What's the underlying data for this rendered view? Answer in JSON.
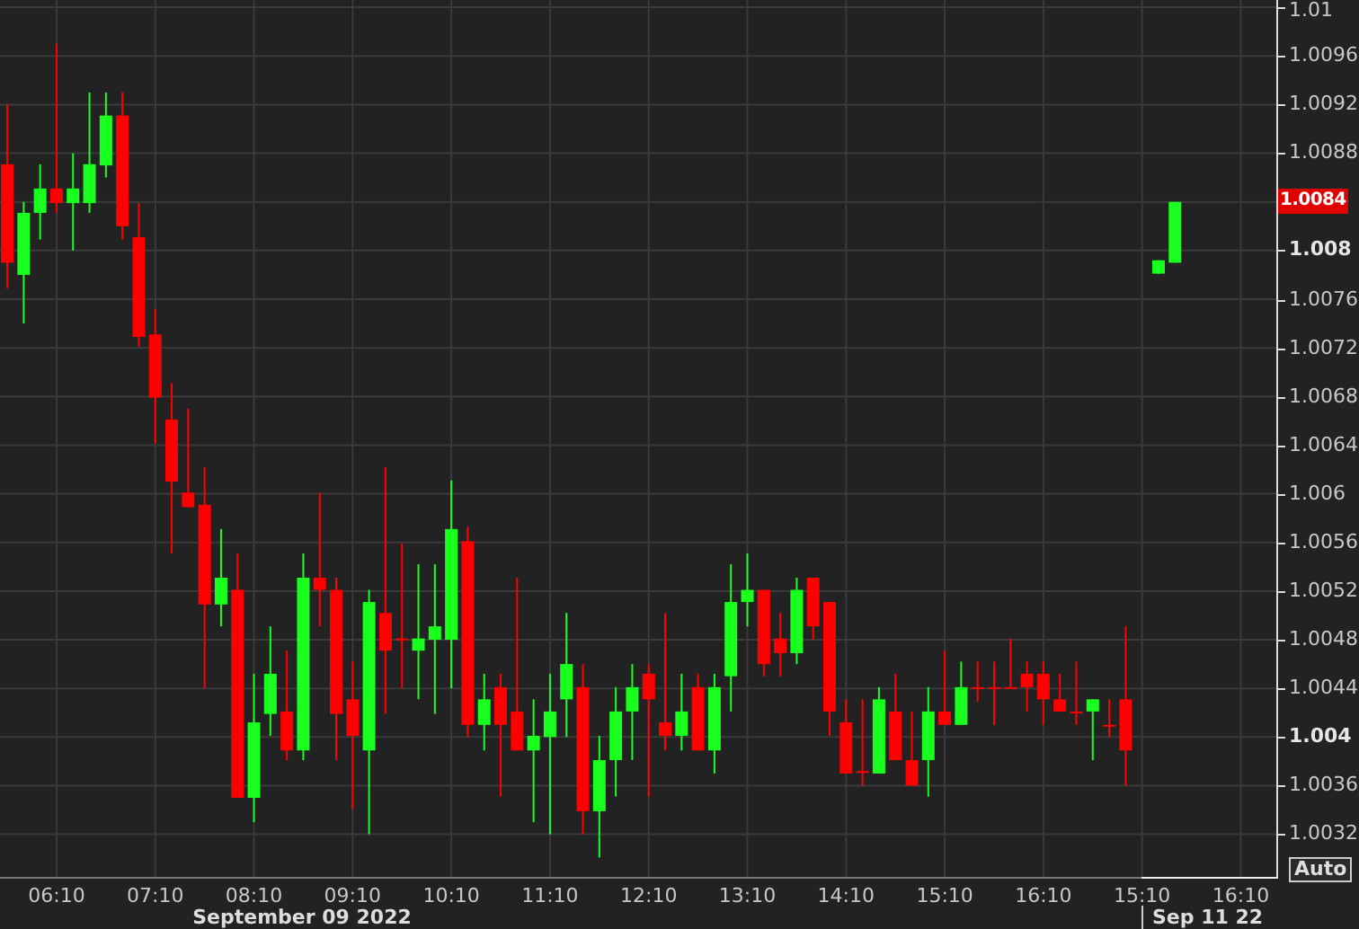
{
  "chart_data": {
    "type": "candlestick",
    "x": [
      5.6667,
      5.8333,
      6,
      6.1667,
      6.3333,
      6.5,
      6.6667,
      6.8333,
      7,
      7.1667,
      7.3333,
      7.5,
      7.6667,
      7.8333,
      8,
      8.1667,
      8.3333,
      8.5,
      8.6667,
      8.8333,
      9,
      9.1667,
      9.3333,
      9.5,
      9.6667,
      9.8333,
      10,
      10.1667,
      10.3333,
      10.5,
      10.6667,
      10.8333,
      11,
      11.1667,
      11.3333,
      11.5,
      11.6667,
      11.8333,
      12,
      12.1667,
      12.3333,
      12.5,
      12.6667,
      12.8333,
      13,
      13.1667,
      13.3333,
      13.5,
      13.6667,
      13.8333,
      14,
      14.1667,
      14.3333,
      14.5,
      14.6667,
      14.8333,
      15,
      15.1667,
      15.3333,
      15.5,
      15.6667,
      15.8333,
      16,
      16.1667,
      16.3333,
      16.5,
      16.6667,
      16.8333,
      17,
      17.3333,
      17.5
    ],
    "ohlc": [
      [
        1.00871,
        1.0092,
        1.00769,
        1.0079
      ],
      [
        1.0078,
        1.0084,
        1.0074,
        1.00831
      ],
      [
        1.00831,
        1.00871,
        1.00809,
        1.00851
      ],
      [
        1.00851,
        1.0097,
        1.00831,
        1.00839
      ],
      [
        1.00839,
        1.0088,
        1.008,
        1.00851
      ],
      [
        1.00839,
        1.0093,
        1.00831,
        1.00871
      ],
      [
        1.0087,
        1.0093,
        1.0086,
        1.00911
      ],
      [
        1.00911,
        1.0093,
        1.00809,
        1.0082
      ],
      [
        1.00811,
        1.00839,
        1.00721,
        1.00729
      ],
      [
        1.00731,
        1.00752,
        1.00641,
        1.00679
      ],
      [
        1.00661,
        1.00691,
        1.00551,
        1.0061
      ],
      [
        1.00601,
        1.0067,
        1.00589,
        1.00589
      ],
      [
        1.00591,
        1.00622,
        1.0044,
        1.00509
      ],
      [
        1.00509,
        1.00571,
        1.00491,
        1.00531
      ],
      [
        1.00521,
        1.00551,
        1.0035,
        1.0035
      ],
      [
        1.0035,
        1.00452,
        1.0033,
        1.00412
      ],
      [
        1.00419,
        1.00491,
        1.00401,
        1.00452
      ],
      [
        1.00421,
        1.00471,
        1.00381,
        1.00389
      ],
      [
        1.00389,
        1.00551,
        1.00381,
        1.00531
      ],
      [
        1.00531,
        1.00601,
        1.00491,
        1.00521
      ],
      [
        1.00521,
        1.00531,
        1.00381,
        1.00419
      ],
      [
        1.00431,
        1.00462,
        1.00341,
        1.00401
      ],
      [
        1.00389,
        1.00521,
        1.0032,
        1.00511
      ],
      [
        1.00502,
        1.00622,
        1.00419,
        1.00471
      ],
      [
        1.00481,
        1.00559,
        1.0044,
        1.00481
      ],
      [
        1.00471,
        1.00542,
        1.00431,
        1.00481
      ],
      [
        1.0048,
        1.00542,
        1.00419,
        1.00491
      ],
      [
        1.0048,
        1.00611,
        1.0044,
        1.00571
      ],
      [
        1.00561,
        1.00573,
        1.004,
        1.0041
      ],
      [
        1.0041,
        1.00452,
        1.00389,
        1.00431
      ],
      [
        1.00441,
        1.00452,
        1.00351,
        1.0041
      ],
      [
        1.00421,
        1.00531,
        1.00389,
        1.00389
      ],
      [
        1.00389,
        1.00431,
        1.0033,
        1.00401
      ],
      [
        1.004,
        1.00452,
        1.0032,
        1.00421
      ],
      [
        1.00431,
        1.00502,
        1.004,
        1.0046
      ],
      [
        1.00441,
        1.0046,
        1.0032,
        1.00339
      ],
      [
        1.00339,
        1.00401,
        1.00301,
        1.00381
      ],
      [
        1.00381,
        1.00441,
        1.00351,
        1.00421
      ],
      [
        1.00421,
        1.0046,
        1.00381,
        1.00441
      ],
      [
        1.00452,
        1.0046,
        1.00351,
        1.00431
      ],
      [
        1.00412,
        1.00502,
        1.00389,
        1.00401
      ],
      [
        1.00401,
        1.00452,
        1.00389,
        1.00421
      ],
      [
        1.00441,
        1.00452,
        1.00389,
        1.00389
      ],
      [
        1.00389,
        1.00452,
        1.0037,
        1.00441
      ],
      [
        1.0045,
        1.00542,
        1.00421,
        1.00511
      ],
      [
        1.00511,
        1.00551,
        1.00491,
        1.00521
      ],
      [
        1.00521,
        1.00521,
        1.0045,
        1.0046
      ],
      [
        1.00481,
        1.00502,
        1.0045,
        1.00469
      ],
      [
        1.00469,
        1.00531,
        1.0046,
        1.00521
      ],
      [
        1.00531,
        1.00531,
        1.0048,
        1.00491
      ],
      [
        1.00511,
        1.00511,
        1.00401,
        1.00421
      ],
      [
        1.00412,
        1.00431,
        1.0037,
        1.0037
      ],
      [
        1.00372,
        1.00431,
        1.0036,
        1.00372
      ],
      [
        1.0037,
        1.00441,
        1.0037,
        1.00431
      ],
      [
        1.00421,
        1.00452,
        1.00381,
        1.00381
      ],
      [
        1.00381,
        1.00421,
        1.0036,
        1.0036
      ],
      [
        1.00381,
        1.00441,
        1.00351,
        1.00421
      ],
      [
        1.00421,
        1.00471,
        1.0041,
        1.0041
      ],
      [
        1.0041,
        1.00462,
        1.0041,
        1.00441
      ],
      [
        1.00441,
        1.00462,
        1.00429,
        1.00441
      ],
      [
        1.00441,
        1.00462,
        1.0041,
        1.00441
      ],
      [
        1.00441,
        1.00481,
        1.00441,
        1.00441
      ],
      [
        1.00452,
        1.00462,
        1.00421,
        1.00441
      ],
      [
        1.00452,
        1.00462,
        1.0041,
        1.00431
      ],
      [
        1.00431,
        1.00452,
        1.00421,
        1.00421
      ],
      [
        1.00421,
        1.00462,
        1.0041,
        1.00421
      ],
      [
        1.00421,
        1.00431,
        1.00381,
        1.00431
      ],
      [
        1.0041,
        1.00431,
        1.004,
        1.0041
      ],
      [
        1.00431,
        1.00491,
        1.0036,
        1.00389
      ],
      [
        1.00781,
        1.00792,
        1.00781,
        1.00792
      ],
      [
        1.0079,
        1.0084,
        1.0079,
        1.0084
      ]
    ],
    "grid": true,
    "xlim": [
      5.5933,
      18.5267
    ],
    "ylim": [
      1.00285,
      1.01006
    ],
    "xticks": [
      {
        "value": 6.1667,
        "label": "06:10"
      },
      {
        "value": 7.1667,
        "label": "07:10"
      },
      {
        "value": 8.1667,
        "label": "08:10"
      },
      {
        "value": 9.1667,
        "label": "09:10"
      },
      {
        "value": 10.1667,
        "label": "10:10"
      },
      {
        "value": 11.1667,
        "label": "11:10"
      },
      {
        "value": 12.1667,
        "label": "12:10"
      },
      {
        "value": 13.1667,
        "label": "13:10"
      },
      {
        "value": 14.1667,
        "label": "14:10"
      },
      {
        "value": 15.1667,
        "label": "15:10"
      },
      {
        "value": 16.1667,
        "label": "16:10"
      }
    ],
    "yticks": [
      {
        "value": 1.01,
        "label": "1.01"
      },
      {
        "value": 1.0096,
        "label": "1.0096"
      },
      {
        "value": 1.0092,
        "label": "1.0092"
      },
      {
        "value": 1.0088,
        "label": "1.0088"
      },
      {
        "value": 1.008,
        "label": "1.008"
      },
      {
        "value": 1.0076,
        "label": "1.0076"
      },
      {
        "value": 1.0072,
        "label": "1.0072"
      },
      {
        "value": 1.0068,
        "label": "1.0068"
      },
      {
        "value": 1.0064,
        "label": "1.0064"
      },
      {
        "value": 1.006,
        "label": "1.006"
      },
      {
        "value": 1.0056,
        "label": "1.0056"
      },
      {
        "value": 1.0052,
        "label": "1.0052"
      },
      {
        "value": 1.0048,
        "label": "1.0048"
      },
      {
        "value": 1.0044,
        "label": "1.0044"
      },
      {
        "value": 1.004,
        "label": "1.004"
      },
      {
        "value": 1.0036,
        "label": "1.0036"
      },
      {
        "value": 1.0032,
        "label": "1.0032"
      }
    ]
  },
  "price_axis": {
    "tick_styles": [
      {
        "bold": false
      },
      {
        "bold": false
      },
      {
        "bold": false
      },
      {
        "bold": false
      },
      {
        "bold": true
      },
      {
        "bold": false
      },
      {
        "bold": false
      },
      {
        "bold": false
      },
      {
        "bold": false
      },
      {
        "bold": false
      },
      {
        "bold": false
      },
      {
        "bold": false
      },
      {
        "bold": false
      },
      {
        "bold": false
      },
      {
        "bold": true
      },
      {
        "bold": false
      },
      {
        "bold": false
      }
    ],
    "current_price": "1.0084",
    "auto_button": "Auto"
  },
  "time_axis": {
    "next_day_labels": [
      "15:10",
      "16:10"
    ],
    "dates": [
      {
        "text": "September 09 2022",
        "kind": "centered"
      },
      {
        "text": "Sep 11 22",
        "kind": "divided"
      }
    ]
  }
}
